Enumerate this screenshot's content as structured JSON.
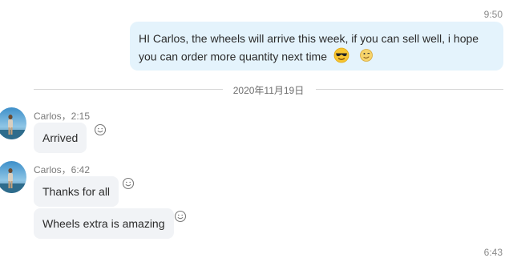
{
  "outgoing": {
    "time": "9:50",
    "text": "HI Carlos, the wheels will arrive this week, if you can sell well, i hope you can order more quantity next time",
    "emojis": [
      "sunglasses-emoji",
      "winking-face-emoji"
    ]
  },
  "date_divider": "2020年11月19日",
  "groups": [
    {
      "sender": "Carlos，2:15",
      "messages": [
        {
          "text": "Arrived"
        }
      ]
    },
    {
      "sender": "Carlos，6:42",
      "messages": [
        {
          "text": "Thanks for all"
        },
        {
          "text": "Wheels extra is amazing"
        }
      ]
    }
  ],
  "next_time_partial": "6:43",
  "colors": {
    "outgoing_bubble": "#e4f3fc",
    "incoming_bubble": "#f1f3f6",
    "meta_text": "#7a7a7a"
  }
}
